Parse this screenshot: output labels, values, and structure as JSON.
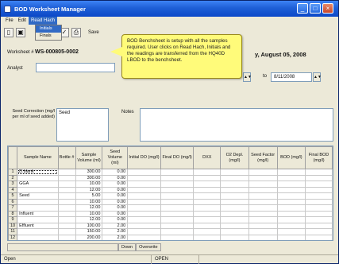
{
  "window": {
    "title": "BOD Worksheet Manager"
  },
  "menu": [
    "File",
    "Edit",
    "Read Hach"
  ],
  "dropdown": [
    "Initials",
    "Finals"
  ],
  "toolbar": {
    "save_label": "Save"
  },
  "header": {
    "worksheet_label": "Worksheet #",
    "worksheet_id": "WS-000805-0002",
    "date_text": "y, August 05, 2008",
    "analyst_label": "Analyst",
    "to_label": "to",
    "end_date": "8/11/2008"
  },
  "seed": {
    "label": "Seed Correction (mg/l per ml of seed added)",
    "value": "Seed"
  },
  "notes": {
    "label": "Notes"
  },
  "callout": {
    "text": "BOD Benchsheet is setup with all the samples required.  User clicks on Read Hach, Initials and the readings are transferred from the HQ40D LBOD to the benchsheet."
  },
  "table": {
    "headers": [
      "",
      "Sample Name",
      "Bottle #",
      "Sample Volume (ml)",
      "Seed Volume (ml)",
      "Initial DO (mg/l)",
      "Final DO (mg/l)",
      "DXX",
      "O2 Depl. (mg/l)",
      "Seed Factor (mg/l)",
      "BOD (mg/l)",
      "Final BOD (mg/l)"
    ],
    "rows": [
      [
        "1",
        "D.blank",
        "",
        "300.00",
        "0.00"
      ],
      [
        "2",
        "",
        "",
        "300.00",
        "0.00"
      ],
      [
        "3",
        "GGA",
        "",
        "10.00",
        "0.00"
      ],
      [
        "4",
        "",
        "",
        "12.00",
        "0.00"
      ],
      [
        "5",
        "Seed",
        "",
        "5.00",
        "0.00"
      ],
      [
        "6",
        "",
        "",
        "10.00",
        "0.00"
      ],
      [
        "7",
        "",
        "",
        "12.00",
        "0.00"
      ],
      [
        "8",
        "Influent",
        "",
        "10.00",
        "0.00"
      ],
      [
        "9",
        "",
        "",
        "12.00",
        "0.00"
      ],
      [
        "10",
        "Effluent",
        "",
        "100.00",
        "2.00"
      ],
      [
        "11",
        "",
        "",
        "150.00",
        "2.00"
      ],
      [
        "12",
        "",
        "",
        "200.00",
        "2.00"
      ]
    ]
  },
  "status": {
    "mode_text": "Down",
    "overwrite": "Overwrite",
    "left": "Open",
    "middle": "OPEN"
  }
}
